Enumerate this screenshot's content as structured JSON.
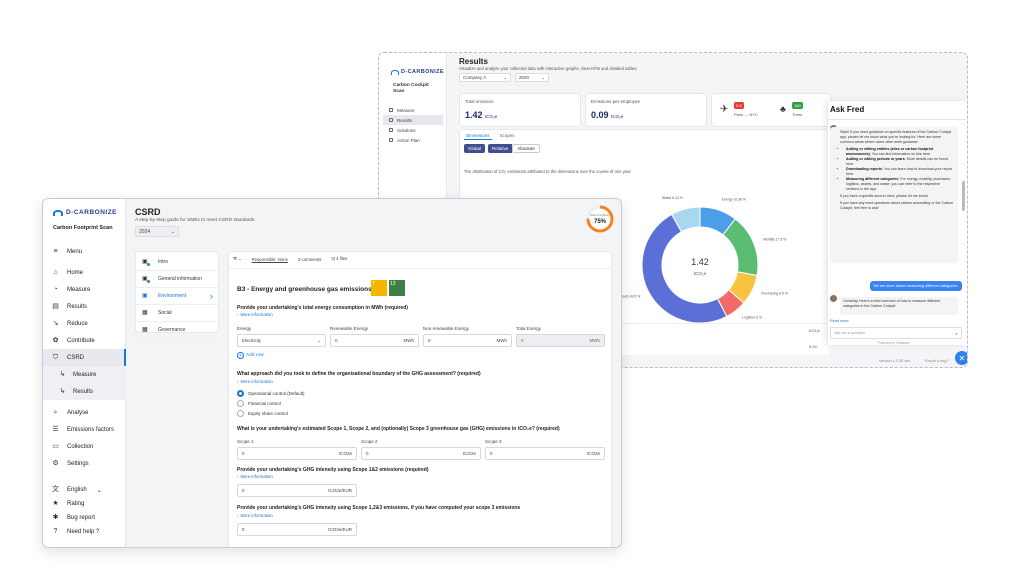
{
  "back": {
    "brand": "D-CARBONIZE",
    "app_name": "Carbon Cockpit Scan",
    "nav": [
      {
        "label": "Measure",
        "icon": "ruler-icon"
      },
      {
        "label": "Results",
        "icon": "search-icon",
        "active": true
      },
      {
        "label": "Solutions",
        "icon": "bulb-icon"
      },
      {
        "label": "Action Plan",
        "icon": "rocket-icon"
      }
    ],
    "page_title": "Results",
    "page_subtitle": "Visualize and analyze your collected data with interactive graphs, clear KPIs and detailed tables.",
    "company_select": "Company A",
    "year_select": "2020",
    "kpis": {
      "total_label": "Total emission",
      "total_value": "1.42",
      "total_unit": "tCO₂e",
      "per_employee_label": "Emissions per employee",
      "per_employee_value": "0.09",
      "per_employee_unit": "tCO₂e",
      "flight_badge": "0.8",
      "flight_label": "Paris ↔ NYC",
      "trees_badge": "160",
      "trees_label": "Trees"
    },
    "tabs": [
      "Dimensions",
      "Scopes"
    ],
    "toggle": [
      "Global",
      "Relative",
      "Absolute"
    ],
    "chart_caption": "The distribution of CO₂ emissions attributed to the dimensions over the course of one year",
    "table_values": [
      "tCO₂e",
      "0.24"
    ],
    "footer_version": "Version 1.3.35 dev",
    "footer_bug": "Found a bug?"
  },
  "chart_data": {
    "type": "pie",
    "center_value": "1.42",
    "center_unit": "tCO₂e",
    "categories": [
      "Energy",
      "Mobility",
      "Purchasing",
      "Logistics",
      "Assets",
      "Waste"
    ],
    "values": [
      10.38,
      17.5,
      8.5,
      6,
      49.5,
      8.12
    ],
    "category_labels": [
      "Energy 10.38 %",
      "Mobility 17.5 %",
      "Purchasing 8.5 %",
      "Logistics 6 %",
      "Assets 49.5 %",
      "Waste 8.12 %"
    ],
    "colors": [
      "#4a9fe8",
      "#5bbd72",
      "#f6c343",
      "#f26b6b",
      "#5b6fd6",
      "#a8d8f0"
    ]
  },
  "chat": {
    "title": "Ask Fred",
    "intro": "Salut! If you need guidance on specific features of the Carbon Cockpit app, please let me know what you're looking for. Here are some common areas where users often seek guidance:",
    "bullets": [
      {
        "bold": "Adding or editing entities (sites or carbon footprint assessments)",
        "text": ": You can find information on this here."
      },
      {
        "bold": "Adding or editing periods or years",
        "text": ": More details can be found here."
      },
      {
        "bold": "Downloading reports",
        "text": ": You can learn how to download your report here."
      },
      {
        "bold": "Measuring different categories",
        "text": ": For energy, mobility, purchases, logistics, assets, and waste, you can refer to the respective sections in the app."
      }
    ],
    "outro1": "If you have a specific area in mind, please let me know!",
    "outro2": "If you have any more questions about carbon accounting or the Carbon Cockpit, feel free to ask!",
    "user_message": "Tell me more about measuring different categories",
    "reply": "Certainly! Here's a brief overview of how to measure different categories in the Carbon Cockpit:",
    "read_more": "Read more",
    "input_placeholder": "Ask me a question",
    "powered": "Powered by Chatbase"
  },
  "front": {
    "brand": "D-CARBONIZE",
    "app_name": "Carbon Footprint Scan",
    "nav": [
      {
        "label": "Menu",
        "icon": "menu-icon",
        "glyph": "≡"
      },
      {
        "label": "Home",
        "icon": "home-icon",
        "glyph": "⌂"
      },
      {
        "label": "Measure",
        "icon": "gauge-icon",
        "glyph": "◔"
      },
      {
        "label": "Results",
        "icon": "bar-chart-icon",
        "glyph": "▤"
      },
      {
        "label": "Reduce",
        "icon": "trend-down-icon",
        "glyph": "↘"
      },
      {
        "label": "Contribute",
        "icon": "plant-icon",
        "glyph": "✿"
      },
      {
        "label": "CSRD",
        "icon": "shield-icon",
        "glyph": "⛉",
        "active": true
      },
      {
        "label": "Measure",
        "icon": "subdirectory-icon",
        "glyph": "↳",
        "sub": true
      },
      {
        "label": "Results",
        "icon": "subdirectory-icon",
        "glyph": "↳",
        "sub": true
      },
      {
        "label": "Analyse",
        "icon": "magnify-icon",
        "glyph": "⌕"
      },
      {
        "label": "Emissions factors",
        "icon": "list-icon",
        "glyph": "☰"
      },
      {
        "label": "Collection",
        "icon": "folder-icon",
        "glyph": "▭"
      },
      {
        "label": "Settings",
        "icon": "gear-icon",
        "glyph": "⚙"
      }
    ],
    "bottom_nav": [
      {
        "label": "English",
        "icon": "translate-icon",
        "glyph": "文"
      },
      {
        "label": "Rating",
        "icon": "star-icon",
        "glyph": "★"
      },
      {
        "label": "Bug report",
        "icon": "bug-icon",
        "glyph": "✱"
      },
      {
        "label": "Need help ?",
        "icon": "help-icon",
        "glyph": "?"
      }
    ],
    "page_title": "CSRD",
    "page_subtitle": "A step-by-step guide for SMEs to meet CSRD standards",
    "year": "2024",
    "progress_label": "Total Completion",
    "progress_value": "75%",
    "progress_fraction": 0.75,
    "sections": [
      {
        "label": "Intro",
        "icon": "info-icon",
        "glyph": "▣",
        "done": true
      },
      {
        "label": "General information",
        "icon": "doc-icon",
        "glyph": "▣",
        "done": true
      },
      {
        "label": "Environment",
        "icon": "leaf-icon",
        "glyph": "▣",
        "active": true
      },
      {
        "label": "Social",
        "icon": "people-icon",
        "glyph": "▦"
      },
      {
        "label": "Governance",
        "icon": "bank-icon",
        "glyph": "▦"
      }
    ],
    "toolbar": {
      "assignee": "Responsible: None",
      "comments": "3 comments",
      "files": "4 files"
    },
    "question_title": "B3 - Energy and greenhouse gas emissions",
    "sdg_badges": [
      "7",
      "13"
    ],
    "q1": "Provide your undertaking's total energy consumption in MWh (required)",
    "more_info": "More information",
    "energy_headers": [
      "Energy",
      "Renewable Energy",
      "Non-renewable Energy",
      "Total Energy"
    ],
    "energy_row": {
      "type": "Electricity",
      "renewable": "0",
      "nonrenewable": "0",
      "total": "0",
      "unit": "MWh"
    },
    "add_row": "Add row",
    "q2": "What approach did you took to define the organisational boundary of the GHG assessment? (required)",
    "options": [
      "Operational control (Default)",
      "Financial control",
      "Equity share control"
    ],
    "q3": "What is your undertaking's estimated Scope 1, Scope 2, and (optionally) Scope 3 greenhouse gas (GHG) emissions in tCO₂e? (required)",
    "scope_headers": [
      "Scope 1",
      "Scope 2",
      "Scope 3"
    ],
    "scope_value": "0",
    "scope_unit": "tCO2e",
    "q4": "Provide your undertaking's GHG intensity using Scope 1&2 emissions (required)",
    "intensity_value": "0",
    "intensity_unit": "tCO2e/EUR",
    "q5": "Provide your undertaking's GHG intensity using Scope 1,2&3 emissions, if you have computed your scope 3 emissions"
  }
}
